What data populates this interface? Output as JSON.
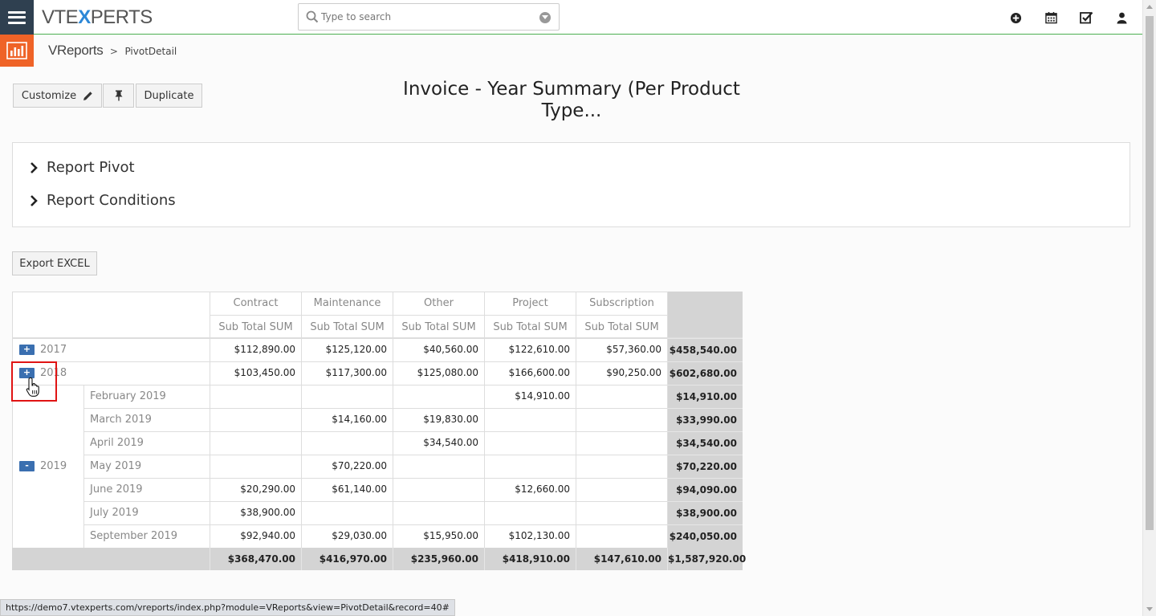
{
  "header": {
    "logo_prefix": "VTE",
    "logo_x": "X",
    "logo_suffix": "PERTS",
    "search_placeholder": "Type to search"
  },
  "breadcrumb": {
    "module": "VReports",
    "separator": ">",
    "current": "PivotDetail"
  },
  "toolbar": {
    "customize_label": "Customize",
    "duplicate_label": "Duplicate"
  },
  "report": {
    "title_line1": "Invoice - Year Summary (Per Product",
    "title_line2": "Type..."
  },
  "panel": {
    "items": [
      {
        "label": "Report Pivot"
      },
      {
        "label": "Report Conditions"
      }
    ]
  },
  "export": {
    "label": "Export EXCEL"
  },
  "pivot": {
    "columns": [
      "Contract",
      "Maintenance",
      "Other",
      "Project",
      "Subscription"
    ],
    "measure": "Sub Total SUM",
    "toggles": {
      "collapsed": "+",
      "expanded": "-"
    },
    "rows": [
      {
        "year": "2017",
        "label": "",
        "values": [
          "$112,890.00",
          "$125,120.00",
          "$40,560.00",
          "$122,610.00",
          "$57,360.00"
        ],
        "total": "$458,540.00"
      },
      {
        "year": "2018",
        "label": "",
        "values": [
          "$103,450.00",
          "$117,300.00",
          "$125,080.00",
          "$166,600.00",
          "$90,250.00"
        ],
        "total": "$602,680.00"
      },
      {
        "year": "",
        "label": "February 2019",
        "values": [
          "",
          "",
          "",
          "$14,910.00",
          ""
        ],
        "total": "$14,910.00"
      },
      {
        "year": "",
        "label": "March 2019",
        "values": [
          "",
          "$14,160.00",
          "$19,830.00",
          "",
          ""
        ],
        "total": "$33,990.00"
      },
      {
        "year": "",
        "label": "April 2019",
        "values": [
          "",
          "",
          "$34,540.00",
          "",
          ""
        ],
        "total": "$34,540.00"
      },
      {
        "year": "2019",
        "label": "May 2019",
        "values": [
          "",
          "$70,220.00",
          "",
          "",
          ""
        ],
        "total": "$70,220.00"
      },
      {
        "year": "",
        "label": "June 2019",
        "values": [
          "$20,290.00",
          "$61,140.00",
          "",
          "$12,660.00",
          ""
        ],
        "total": "$94,090.00"
      },
      {
        "year": "",
        "label": "July 2019",
        "values": [
          "$38,900.00",
          "",
          "",
          "",
          ""
        ],
        "total": "$38,900.00"
      },
      {
        "year": "",
        "label": "September 2019",
        "values": [
          "$92,940.00",
          "$29,030.00",
          "$15,950.00",
          "$102,130.00",
          ""
        ],
        "total": "$240,050.00"
      }
    ],
    "grand_totals": [
      "$368,470.00",
      "$416,970.00",
      "$235,960.00",
      "$418,910.00",
      "$147,610.00"
    ],
    "grand_total": "$1,587,920.00"
  },
  "status": {
    "url": "https://demo7.vtexperts.com/vreports/index.php?module=VReports&view=PivotDetail&record=40#"
  },
  "colors": {
    "sidebar_dark": "#2f4050",
    "module_orange": "#ef6327",
    "accent_green": "#4caf50",
    "toggle_blue": "#3a6fb0",
    "total_grey": "#d4d4d4",
    "highlight_red": "#e01414"
  }
}
